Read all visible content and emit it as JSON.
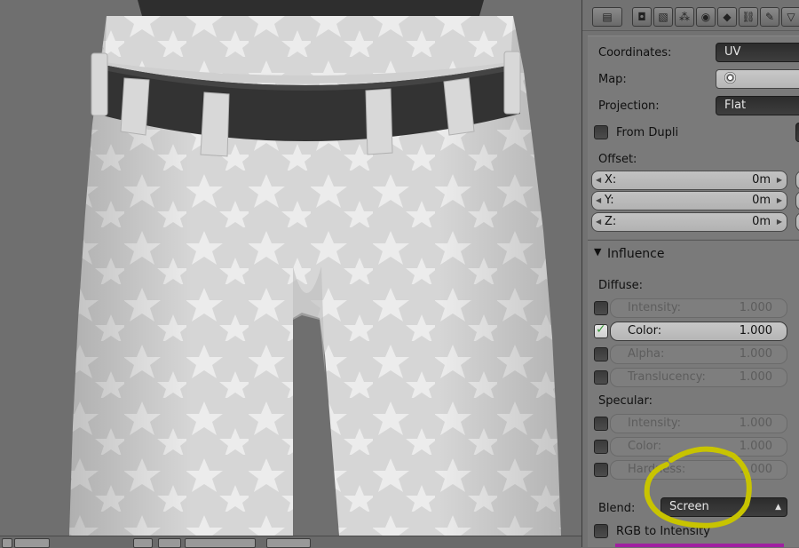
{
  "panel": {
    "coordinates": {
      "label": "Coordinates:",
      "value": "UV"
    },
    "map": {
      "label": "Map:"
    },
    "projection": {
      "label": "Projection:",
      "value": "Flat"
    },
    "from_dupli": {
      "label": "From Dupli",
      "checked": false
    },
    "offset": {
      "label": "Offset:",
      "x": {
        "label": "X:",
        "value": "0m"
      },
      "y": {
        "label": "Y:",
        "value": "0m"
      },
      "z": {
        "label": "Z:",
        "value": "0m"
      }
    },
    "influence": {
      "title": "Influence",
      "diffuse_label": "Diffuse:",
      "diffuse": [
        {
          "label": "Intensity:",
          "value": "1.000",
          "checked": false
        },
        {
          "label": "Color:",
          "value": "1.000",
          "checked": true
        },
        {
          "label": "Alpha:",
          "value": "1.000",
          "checked": false
        },
        {
          "label": "Translucency:",
          "value": "1.000",
          "checked": false
        }
      ],
      "specular_label": "Specular:",
      "specular": [
        {
          "label": "Intensity:",
          "value": "1.000",
          "checked": false
        },
        {
          "label": "Color:",
          "value": "1.000",
          "checked": false
        },
        {
          "label": "Hardness:",
          "value": "1.000",
          "checked": false
        }
      ],
      "blend": {
        "label": "Blend:",
        "value": "Screen"
      },
      "rgb_to_intensity": {
        "label": "RGB to Intensity",
        "checked": false
      }
    }
  },
  "colors": {
    "panel_bg": "#727272",
    "viewport_bg": "#6f6f6f",
    "annotation": "#c8c400"
  },
  "icons": [
    "editor-type-icon",
    "render-icon",
    "render-layers-icon",
    "scene-icon",
    "world-icon",
    "object-icon",
    "constraints-icon",
    "modifiers-icon",
    "data-icon"
  ]
}
